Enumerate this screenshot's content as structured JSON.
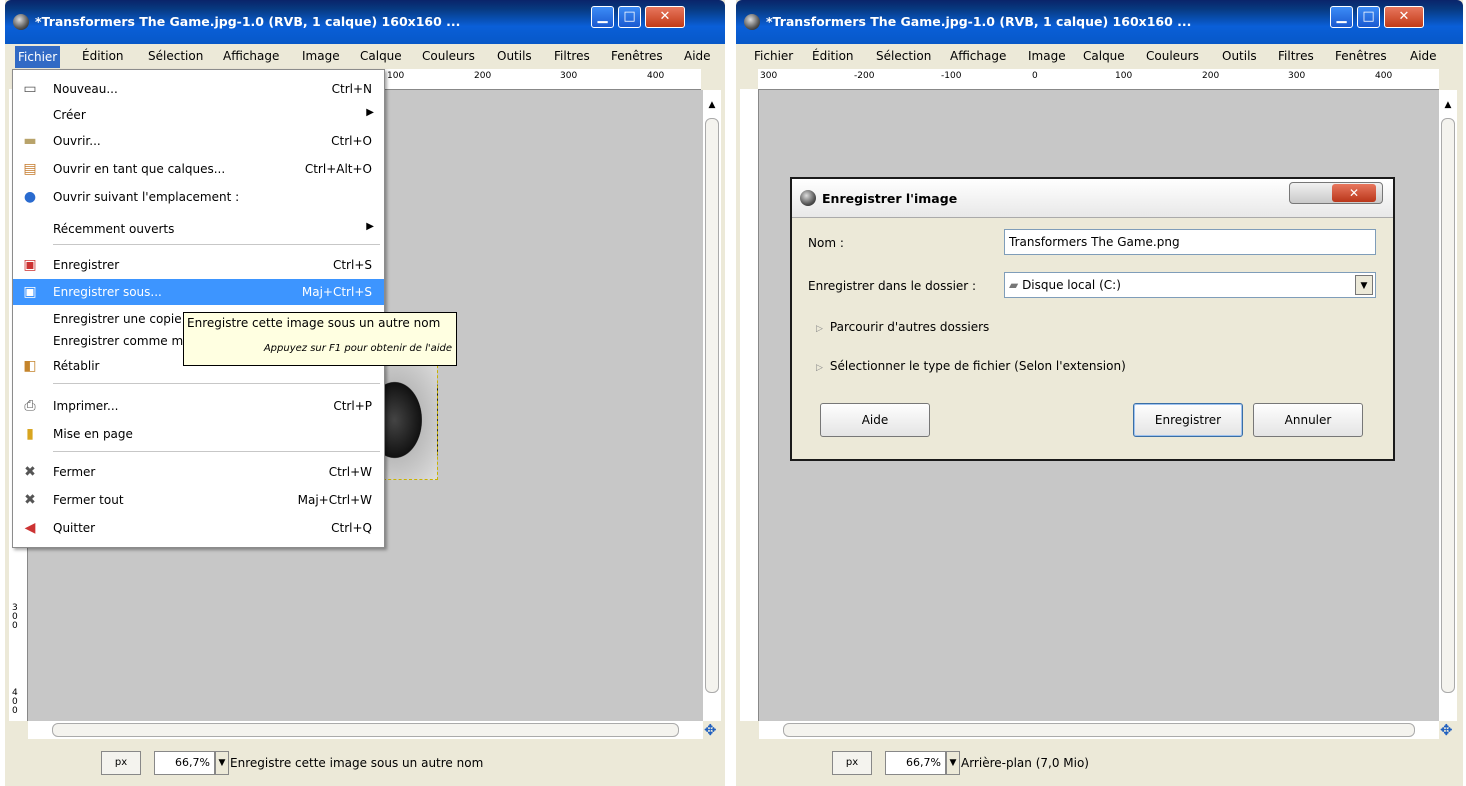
{
  "left_window": {
    "title": "*Transformers The Game.jpg-1.0 (RVB, 1 calque) 160x160 ...",
    "menu": [
      "Fichier",
      "Édition",
      "Sélection",
      "Affichage",
      "Image",
      "Calque",
      "Couleurs",
      "Outils",
      "Filtres",
      "Fenêtres",
      "Aide"
    ],
    "ruler_labels": [
      "100",
      "200",
      "300",
      "400"
    ],
    "left_ruler_labels": [
      "3",
      "0",
      "0",
      "4",
      "0",
      "0"
    ],
    "status": {
      "unit": "px",
      "zoom": "66,7%",
      "message": "Enregistre cette image sous un autre nom"
    }
  },
  "file_menu": [
    {
      "icon": "new-document-icon",
      "label": "Nouveau...",
      "shortcut": "Ctrl+N"
    },
    {
      "icon": "",
      "label": "Créer",
      "shortcut": "",
      "submenu": true
    },
    {
      "icon": "open-folder-icon",
      "label": "Ouvrir...",
      "shortcut": "Ctrl+O"
    },
    {
      "icon": "open-as-layers-icon",
      "label": "Ouvrir en tant que calques...",
      "shortcut": "Ctrl+Alt+O"
    },
    {
      "icon": "globe-icon",
      "label": "Ouvrir suivant l'emplacement :",
      "shortcut": ""
    },
    {
      "icon": "",
      "label": "Récemment ouverts",
      "shortcut": "",
      "submenu": true
    },
    {
      "icon": "save-icon",
      "label": "Enregistrer",
      "shortcut": "Ctrl+S"
    },
    {
      "icon": "save-as-icon",
      "label": "Enregistrer sous...",
      "shortcut": "Maj+Ctrl+S",
      "highlighted": true
    },
    {
      "icon": "",
      "label": "Enregistrer une copie",
      "shortcut": ""
    },
    {
      "icon": "",
      "label": "Enregistrer comme m",
      "shortcut": ""
    },
    {
      "icon": "revert-icon",
      "label": "Rétablir",
      "shortcut": ""
    },
    {
      "icon": "print-icon",
      "label": "Imprimer...",
      "shortcut": "Ctrl+P"
    },
    {
      "icon": "page-setup-icon",
      "label": "Mise en page",
      "shortcut": ""
    },
    {
      "icon": "close-x-icon",
      "label": "Fermer",
      "shortcut": "Ctrl+W"
    },
    {
      "icon": "close-all-icon",
      "label": "Fermer tout",
      "shortcut": "Maj+Ctrl+W"
    },
    {
      "icon": "quit-icon",
      "label": "Quitter",
      "shortcut": "Ctrl+Q"
    }
  ],
  "tooltip": {
    "text": "Enregistre cette image sous un autre nom",
    "hint": "Appuyez sur F1 pour obtenir de l'aide"
  },
  "right_window": {
    "title": "*Transformers The Game.jpg-1.0 (RVB, 1 calque) 160x160 ...",
    "menu": [
      "Fichier",
      "Édition",
      "Sélection",
      "Affichage",
      "Image",
      "Calque",
      "Couleurs",
      "Outils",
      "Filtres",
      "Fenêtres",
      "Aide"
    ],
    "ruler_labels": [
      "300",
      "-200",
      "-100",
      "0",
      "100",
      "200",
      "300",
      "400"
    ],
    "status": {
      "unit": "px",
      "zoom": "66,7%",
      "message": "Arrière-plan (7,0 Mio)"
    }
  },
  "save_dialog": {
    "title": "Enregistrer l'image",
    "name_label": "Nom :",
    "name_value": "Transformers The Game.png",
    "folder_label": "Enregistrer dans le dossier :",
    "folder_value": "Disque local (C:)",
    "browse_label": "Parcourir d'autres dossiers",
    "filetype_label": "Sélectionner le type de fichier (Selon l'extension)",
    "help_button": "Aide",
    "save_button": "Enregistrer",
    "cancel_button": "Annuler"
  }
}
